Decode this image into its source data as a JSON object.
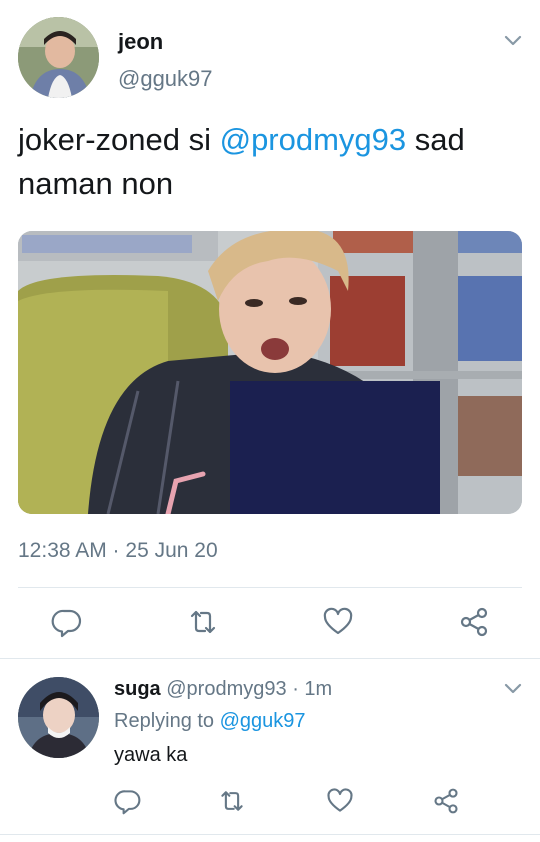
{
  "tweet": {
    "display_name": "jeon",
    "handle": "@gguk97",
    "text_prefix": "joker-zoned si ",
    "mention": "@prodmyg93",
    "text_suffix": " sad",
    "text_line2": "naman non",
    "timestamp": "12:38 AM · 25 Jun 20"
  },
  "reply": {
    "display_name": "suga",
    "handle": "@prodmyg93",
    "time": "· 1m",
    "replying_label": "Replying to ",
    "replying_to": "@gguk97",
    "text": "yawa ka"
  },
  "icons": {
    "reply": "reply-icon",
    "retweet": "retweet-icon",
    "like": "heart-icon",
    "share": "share-icon",
    "more": "chevron-down-icon"
  },
  "colors": {
    "link": "#1b95e0",
    "secondary_text": "#657786",
    "icon": "#657786",
    "divider": "#e1e8ed"
  }
}
